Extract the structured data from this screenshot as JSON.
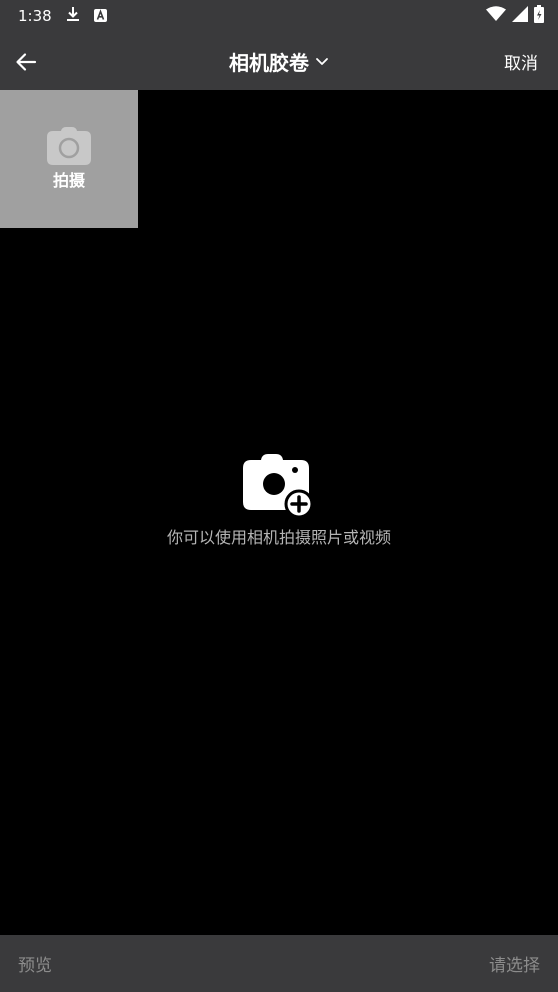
{
  "status_bar": {
    "time": "1:38",
    "icons": [
      "download-icon",
      "notification-a-icon",
      "wifi-icon",
      "signal-icon",
      "battery-icon"
    ]
  },
  "app_bar": {
    "title": "相机胶卷",
    "cancel_label": "取消"
  },
  "camera_tile": {
    "label": "拍摄"
  },
  "empty_state": {
    "message": "你可以使用相机拍摄照片或视频"
  },
  "bottom_bar": {
    "preview_label": "预览",
    "select_label": "请选择"
  },
  "colors": {
    "bar_background": "#3a3a3c",
    "content_background": "#000000",
    "tile_background": "#a0a0a0",
    "muted_text": "#8c8c8c"
  }
}
